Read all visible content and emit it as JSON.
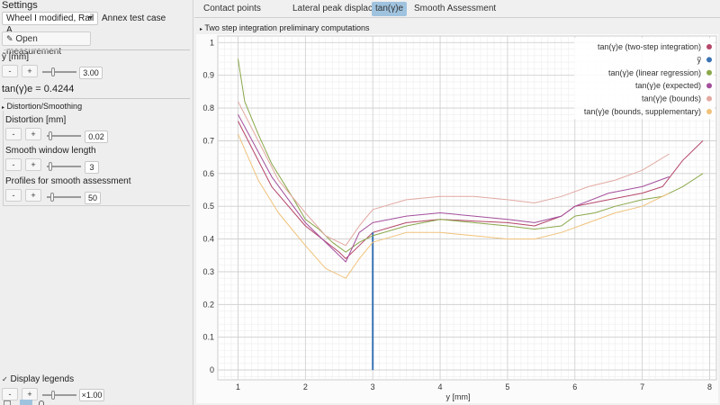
{
  "left": {
    "settings_title": "Settings",
    "wheel_select": "Wheel I modified, Rail A",
    "test_case": "Annex test case",
    "open_measurement": "Open measurement",
    "ytilde_label": "ỹ [mm]",
    "ytilde_minus": "-",
    "ytilde_plus": "+",
    "ytilde_value": "3.00",
    "tan_readout": "tan(γ)e = 0.4244",
    "distortion_section": "Distortion/Smoothing",
    "distortion_label": "Distortion [mm]",
    "distortion_minus": "-",
    "distortion_plus": "+",
    "distortion_value": "0.02",
    "window_label": "Smooth window length",
    "window_minus": "-",
    "window_plus": "+",
    "window_value": "3",
    "profiles_label": "Profiles for smooth assessment",
    "profiles_minus": "-",
    "profiles_plus": "+",
    "profiles_value": "50",
    "display_legends": "Display legends",
    "zoom_minus": "-",
    "zoom_plus": "+",
    "zoom_value": "×1.00"
  },
  "tabs": [
    {
      "label": "Contact points",
      "active": false
    },
    {
      "label": "Lateral peak displacements",
      "active": false
    },
    {
      "label": "tan(γ)e",
      "active": true
    },
    {
      "label": "Smooth Assessment",
      "active": false
    }
  ],
  "section_header": "Two step integration preliminary computations",
  "chart_data": {
    "type": "line",
    "xlabel": "y [mm]",
    "ylabel": "",
    "xlim": [
      0.7,
      8.1
    ],
    "ylim": [
      -0.03,
      1.02
    ],
    "xticks": [
      1,
      2,
      3,
      4,
      5,
      6,
      7,
      8
    ],
    "yticks": [
      0,
      0.1,
      0.2,
      0.3,
      0.4,
      0.5,
      0.6,
      0.7,
      0.8,
      0.9,
      1
    ],
    "legend_position": "top-right",
    "series": [
      {
        "name": "tan(γ)e (two-step integration)",
        "color": "#b5476a",
        "x": [
          1,
          1.5,
          2,
          2.5,
          2.6,
          2.8,
          3,
          3.5,
          4,
          4.5,
          5,
          5.4,
          5.8,
          6,
          6.5,
          7,
          7.3,
          7.6,
          7.9
        ],
        "y": [
          0.76,
          0.56,
          0.44,
          0.36,
          0.34,
          0.38,
          0.42,
          0.45,
          0.46,
          0.455,
          0.45,
          0.44,
          0.47,
          0.5,
          0.52,
          0.54,
          0.56,
          0.64,
          0.7
        ]
      },
      {
        "name": "ỹ",
        "color": "#3a73b3",
        "x": [
          3,
          3
        ],
        "y": [
          0,
          0.42
        ]
      },
      {
        "name": "tan(γ)e (linear regression)",
        "color": "#8aa84a",
        "x": [
          1,
          1.1,
          1.3,
          1.5,
          1.8,
          2,
          2.2,
          2.4,
          2.6,
          2.8,
          3,
          3.5,
          4,
          4.5,
          5,
          5.4,
          5.8,
          6,
          6.3,
          6.6,
          7,
          7.3,
          7.6,
          7.9
        ],
        "y": [
          0.95,
          0.82,
          0.72,
          0.63,
          0.53,
          0.46,
          0.43,
          0.39,
          0.36,
          0.39,
          0.41,
          0.44,
          0.46,
          0.45,
          0.44,
          0.43,
          0.44,
          0.47,
          0.48,
          0.5,
          0.52,
          0.53,
          0.56,
          0.6
        ]
      },
      {
        "name": "tan(γ)e (expected)",
        "color": "#a44f9c",
        "x": [
          1,
          1.5,
          2,
          2.4,
          2.6,
          2.8,
          3,
          3.5,
          4,
          4.5,
          5,
          5.4,
          5.8,
          6,
          6.5,
          7,
          7.4
        ],
        "y": [
          0.78,
          0.59,
          0.45,
          0.37,
          0.33,
          0.42,
          0.45,
          0.47,
          0.48,
          0.47,
          0.46,
          0.45,
          0.47,
          0.5,
          0.54,
          0.56,
          0.59
        ]
      },
      {
        "name": "tan(γ)e (bounds)",
        "color": "#e2a9a2",
        "x": [
          1,
          1.3,
          1.6,
          2,
          2.3,
          2.6,
          2.8,
          3,
          3.5,
          4,
          4.5,
          5,
          5.4,
          5.8,
          6.2,
          6.6,
          7,
          7.4
        ],
        "y": [
          0.82,
          0.7,
          0.58,
          0.48,
          0.41,
          0.38,
          0.44,
          0.49,
          0.52,
          0.53,
          0.53,
          0.52,
          0.51,
          0.53,
          0.56,
          0.58,
          0.61,
          0.66
        ]
      },
      {
        "name": "tan(γ)e (bounds, supplementary)",
        "color": "#f0c27a",
        "x": [
          1,
          1.3,
          1.6,
          2,
          2.3,
          2.6,
          2.8,
          3,
          3.5,
          4,
          4.5,
          5,
          5.4,
          5.8,
          6.2,
          6.6,
          7,
          7.4
        ],
        "y": [
          0.72,
          0.58,
          0.48,
          0.38,
          0.31,
          0.28,
          0.34,
          0.39,
          0.42,
          0.42,
          0.41,
          0.4,
          0.4,
          0.42,
          0.45,
          0.48,
          0.5,
          0.54
        ]
      }
    ]
  }
}
